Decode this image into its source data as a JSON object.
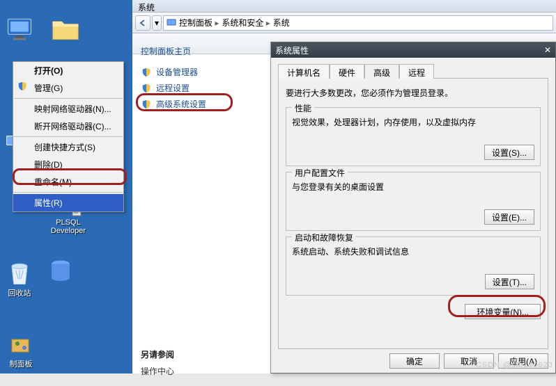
{
  "desktop": {
    "icons": {
      "plsql_label": "PLSQL\nDeveloper",
      "recycle_label": "回收站",
      "taskbar_label": "制面板"
    }
  },
  "context_menu": {
    "open": "打开(O)",
    "manage": "管理(G)",
    "map_drive": "映射网络驱动器(N)...",
    "disconnect_drive": "断开网络驱动器(C)...",
    "create_shortcut": "创建快捷方式(S)",
    "delete": "删除(D)",
    "rename": "重命名(M)",
    "properties": "属性(R)"
  },
  "explorer": {
    "window_title": "系统",
    "breadcrumb": [
      "控制面板",
      "系统和安全",
      "系统"
    ],
    "leftnav": {
      "home": "控制面板主页",
      "device_mgr": "设备管理器",
      "remote": "远程设置",
      "advanced": "高级系统设置",
      "see_also": "另请参阅",
      "see_item": "操作中心"
    }
  },
  "sysprops": {
    "title": "系统属性",
    "tabs": {
      "computer": "计算机名",
      "hardware": "硬件",
      "advanced": "高级",
      "remote": "远程"
    },
    "desc": "要进行大多数更改，您必须作为管理员登录。",
    "perf": {
      "legend": "性能",
      "txt": "视觉效果，处理器计划，内存使用，以及虚拟内存",
      "btn": "设置(S)..."
    },
    "profile": {
      "legend": "用户配置文件",
      "txt": "与您登录有关的桌面设置",
      "btn": "设置(E)..."
    },
    "startup": {
      "legend": "启动和故障恢复",
      "txt": "系统启动、系统失败和调试信息",
      "btn": "设置(T)..."
    },
    "env_btn": "环境变量(N)...",
    "ok": "确定",
    "cancel": "取消",
    "apply": "应用(A)"
  },
  "watermark": "CSDN @slb190623"
}
